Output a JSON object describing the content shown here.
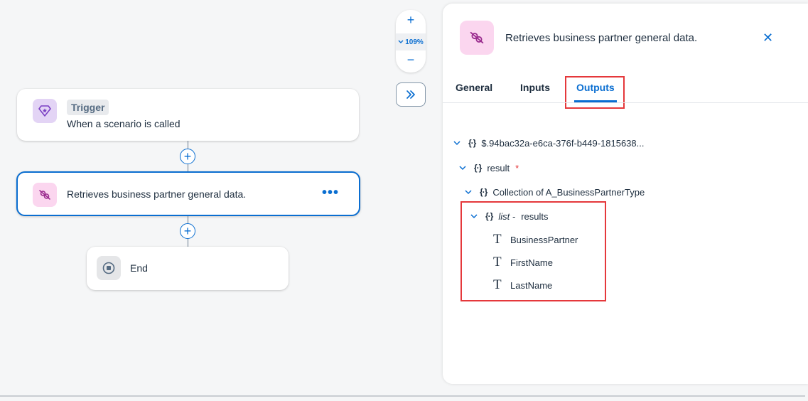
{
  "flow": {
    "trigger": {
      "badge": "Trigger",
      "text": "When a scenario is called"
    },
    "step": {
      "text": "Retrieves business partner general data.",
      "more_label": "•••"
    },
    "end": {
      "text": "End"
    },
    "add_symbol": "+"
  },
  "zoom": {
    "in_label": "+",
    "level": "109%",
    "out_label": "−"
  },
  "panel": {
    "title": "Retrieves business partner general data.",
    "close_label": "✕",
    "tabs": [
      {
        "label": "General"
      },
      {
        "label": "Inputs"
      },
      {
        "label": "Outputs",
        "active": true
      }
    ],
    "tree": {
      "root": "$.94bac32a-e6ca-376f-b449-1815638...",
      "result": "result",
      "required_marker": "*",
      "collection": "Collection of A_BusinessPartnerType",
      "list_label": "list -",
      "list_name": "results",
      "fields": [
        "BusinessPartner",
        "FirstName",
        "LastName"
      ]
    }
  },
  "colors": {
    "accent": "#0a6ed1",
    "highlight": "#e5383b",
    "trigger_tile": "#e3d4f5",
    "step_tile": "#fbd6ef"
  }
}
